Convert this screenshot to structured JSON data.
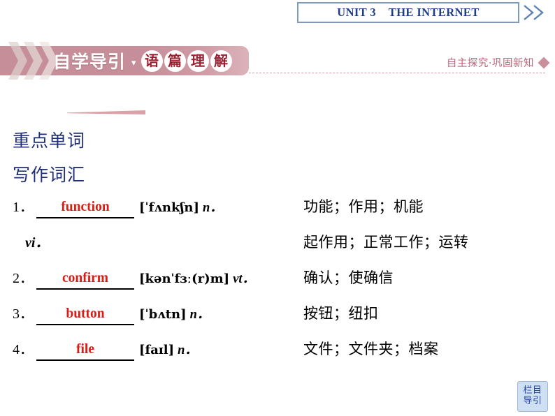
{
  "header": {
    "unit_title": "UNIT 3    THE INTERNET",
    "chevron_icon": "double-chevron-right"
  },
  "section": {
    "title_main": "自学导引",
    "separator": "▾",
    "circled_chars": [
      "语",
      "篇",
      "理",
      "解"
    ],
    "right_subtitle": "自主探究·巩固新知",
    "diamond_icon": "diamond-marker",
    "chevron_icon": "chevron-right-decor"
  },
  "headings": {
    "keywords": "重点单词",
    "writing_vocab": "写作词汇"
  },
  "vocabulary": [
    {
      "number": "1．",
      "answer": "function",
      "phonetic": "[ˈfʌnkʃn]",
      "pos": "n．",
      "meaning": "功能；作用；机能"
    },
    {
      "number": "",
      "answer": "",
      "phonetic": "",
      "pos": "vi．",
      "meaning": "起作用；正常工作；运转"
    },
    {
      "number": "2．",
      "answer": "confirm",
      "phonetic": "[kənˈfɜː(r)m]",
      "pos": "vt．",
      "meaning": "确认；使确信"
    },
    {
      "number": "3．",
      "answer": "button",
      "phonetic": "[ˈbʌtn]",
      "pos": "n．",
      "meaning": "按钮；纽扣"
    },
    {
      "number": "4．",
      "answer": "file",
      "phonetic": "[faɪl]",
      "pos": "n．",
      "meaning": "文件；文件夹；档案"
    }
  ],
  "nav_button": {
    "line1": "栏目",
    "line2": "导引"
  },
  "colors": {
    "unit_text": "#1f3e86",
    "unit_border": "#7b9ac4",
    "banner_rose": "#c58e99",
    "circle_char_text": "#9c2233",
    "heading_navy": "#1f2f7a",
    "answer_red": "#d71d16",
    "subtitle_rose": "#b9677a",
    "nav_bg": "#cfe0f2",
    "nav_text": "#24459a"
  }
}
